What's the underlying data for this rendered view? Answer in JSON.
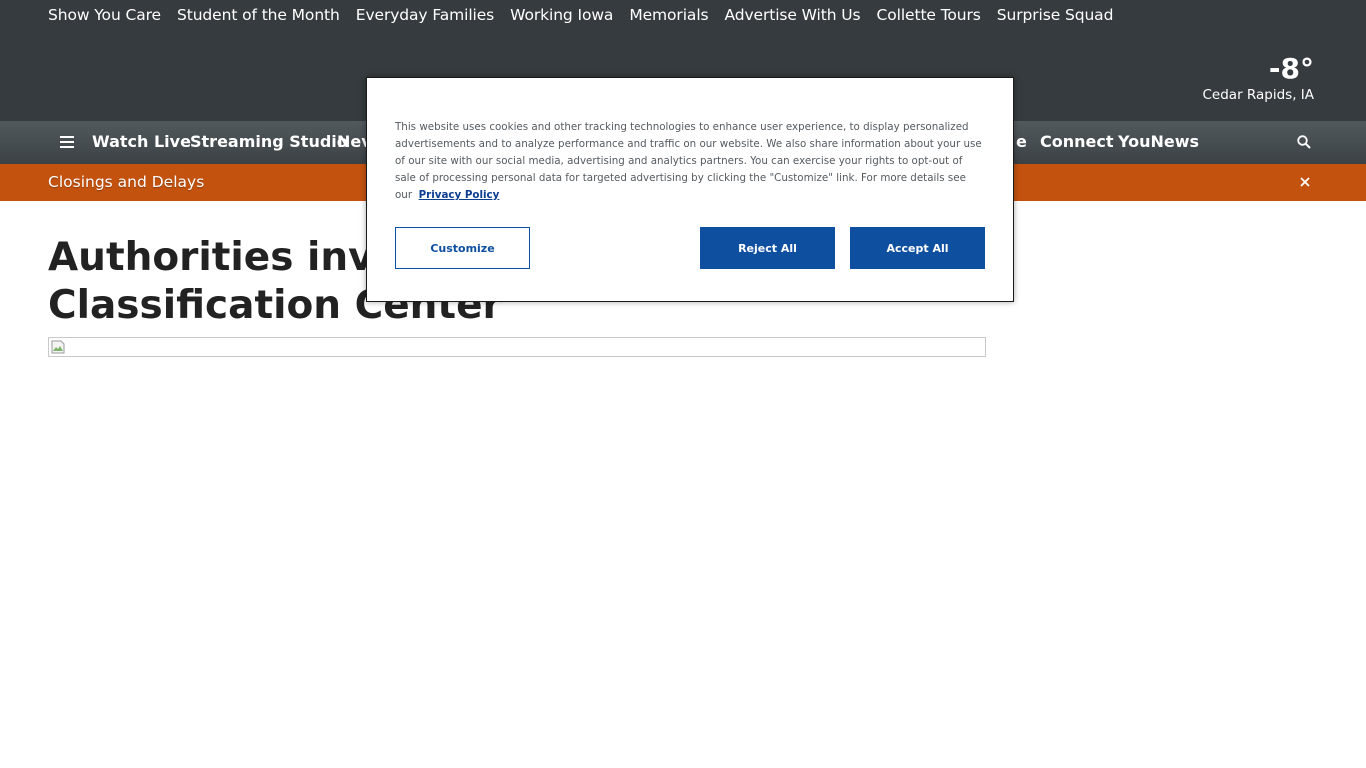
{
  "utility_nav": [
    "Show You Care",
    "Student of the Month",
    "Everyday Families",
    "Working Iowa",
    "Memorials",
    "Advertise With Us",
    "Collette Tours",
    "Surprise Squad"
  ],
  "weather": {
    "temperature": "-8°",
    "location": "Cedar Rapids, IA"
  },
  "main_nav": {
    "menu_icon": "hamburger-menu-icon",
    "items_left": [
      "Watch Live",
      "Streaming Studio",
      "Nev"
    ],
    "items_right": [
      "e",
      "Connect",
      "YouNews"
    ],
    "search_icon": "search-icon"
  },
  "alert_bar": {
    "label": "Closings and Delays",
    "close_icon": "close-icon"
  },
  "article": {
    "headline_line1": "Authorities inves",
    "headline_line2": "Classification Center"
  },
  "cookie_banner": {
    "text": "This website uses cookies and other tracking technologies to enhance user experience, to display personalized advertisements and to analyze performance and traffic on our website. We also share information about your use of our site with our social media, advertising and analytics partners. You can exercise your rights to opt-out of sale of processing personal data for targeted advertising by clicking the \"Customize\" link. For more details see our",
    "policy_link": "Privacy Policy",
    "customize_label": "Customize",
    "reject_label": "Reject All",
    "accept_label": "Accept All"
  },
  "colors": {
    "header_bg": "#353b3e",
    "alert_bg": "#c4520f",
    "button_blue": "#0f4fa0"
  }
}
